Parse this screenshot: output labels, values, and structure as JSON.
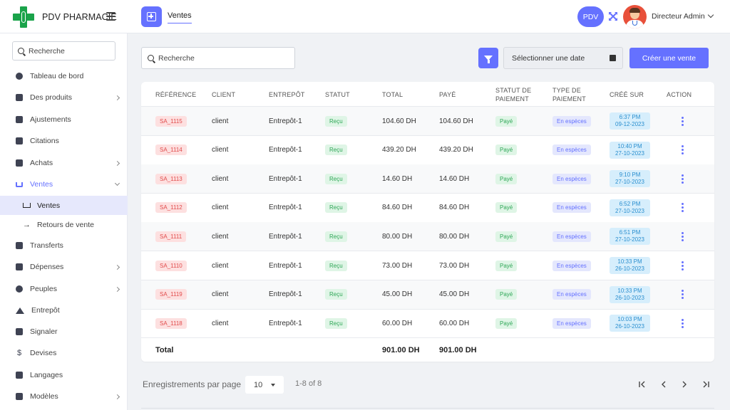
{
  "brand": {
    "name": "PDV PHARMACIE"
  },
  "header": {
    "tab_label": "Ventes",
    "pdv_label": "PDV",
    "user_name": "Directeur Admin"
  },
  "sidebar": {
    "search_placeholder": "Recherche",
    "items": [
      {
        "label": "Tableau de bord",
        "icon": "dashboard-icon"
      },
      {
        "label": "Des produits",
        "icon": "products-icon"
      },
      {
        "label": "Ajustements",
        "icon": "adjustments-icon"
      },
      {
        "label": "Citations",
        "icon": "quotations-icon"
      },
      {
        "label": "Achats",
        "icon": "purchases-icon"
      },
      {
        "label": "Ventes",
        "icon": "cart-icon"
      },
      {
        "label": "Transferts",
        "icon": "transfers-icon"
      },
      {
        "label": "Dépenses",
        "icon": "expenses-icon"
      },
      {
        "label": "Peuples",
        "icon": "people-icon"
      },
      {
        "label": "Entrepôt",
        "icon": "warehouse-icon"
      },
      {
        "label": "Signaler",
        "icon": "report-icon"
      },
      {
        "label": "Devises",
        "icon": "dollar-icon"
      },
      {
        "label": "Langages",
        "icon": "languages-icon"
      },
      {
        "label": "Modèles",
        "icon": "templates-icon"
      }
    ],
    "sub_items": [
      {
        "label": "Ventes",
        "icon": "cart-icon"
      },
      {
        "label": "Retours de vente",
        "icon": "arrow-right-icon"
      }
    ]
  },
  "toolbar": {
    "search_placeholder": "Recherche",
    "date_placeholder": "Sélectionner une date",
    "create_label": "Créer une vente"
  },
  "table": {
    "headers": {
      "reference": "RÉFÉRENCE",
      "client": "CLIENT",
      "warehouse": "ENTREPÔT",
      "status": "STATUT",
      "total": "TOTAL",
      "paid": "PAYÉ",
      "payment_status_1": "STATUT DE",
      "payment_status_2": "PAIEMENT",
      "payment_type_1": "TYPE DE",
      "payment_type_2": "PAIEMENT",
      "created_at": "CRÉÉ SUR",
      "action": "ACTION"
    },
    "rows": [
      {
        "ref": "SA_1115",
        "client": "client",
        "warehouse": "Entrepôt-1",
        "status": "Reçu",
        "total": "104.60 DH",
        "paid": "104.60 DH",
        "payment_status": "Payé",
        "payment_type": "En espèces",
        "time": "6:37 PM",
        "date": "09-12-2023"
      },
      {
        "ref": "SA_1114",
        "client": "client",
        "warehouse": "Entrepôt-1",
        "status": "Reçu",
        "total": "439.20 DH",
        "paid": "439.20 DH",
        "payment_status": "Payé",
        "payment_type": "En espèces",
        "time": "10:40 PM",
        "date": "27-10-2023"
      },
      {
        "ref": "SA_1113",
        "client": "client",
        "warehouse": "Entrepôt-1",
        "status": "Reçu",
        "total": "14.60 DH",
        "paid": "14.60 DH",
        "payment_status": "Payé",
        "payment_type": "En espèces",
        "time": "9:10 PM",
        "date": "27-10-2023"
      },
      {
        "ref": "SA_1112",
        "client": "client",
        "warehouse": "Entrepôt-1",
        "status": "Reçu",
        "total": "84.60 DH",
        "paid": "84.60 DH",
        "payment_status": "Payé",
        "payment_type": "En espèces",
        "time": "6:52 PM",
        "date": "27-10-2023"
      },
      {
        "ref": "SA_1111",
        "client": "client",
        "warehouse": "Entrepôt-1",
        "status": "Reçu",
        "total": "80.00 DH",
        "paid": "80.00 DH",
        "payment_status": "Payé",
        "payment_type": "En espèces",
        "time": "6:51 PM",
        "date": "27-10-2023"
      },
      {
        "ref": "SA_1110",
        "client": "client",
        "warehouse": "Entrepôt-1",
        "status": "Reçu",
        "total": "73.00 DH",
        "paid": "73.00 DH",
        "payment_status": "Payé",
        "payment_type": "En espèces",
        "time": "10:33 PM",
        "date": "26-10-2023"
      },
      {
        "ref": "SA_1119",
        "client": "client",
        "warehouse": "Entrepôt-1",
        "status": "Reçu",
        "total": "45.00 DH",
        "paid": "45.00 DH",
        "payment_status": "Payé",
        "payment_type": "En espèces",
        "time": "10:33 PM",
        "date": "26-10-2023"
      },
      {
        "ref": "SA_1118",
        "client": "client",
        "warehouse": "Entrepôt-1",
        "status": "Reçu",
        "total": "60.00 DH",
        "paid": "60.00 DH",
        "payment_status": "Payé",
        "payment_type": "En espèces",
        "time": "10:03 PM",
        "date": "26-10-2023"
      }
    ],
    "total_label": "Total",
    "total_amount": "901.00 DH",
    "total_paid": "901.00 DH"
  },
  "pagination": {
    "per_page_label": "Enregistrements par page",
    "per_page_value": "10",
    "range": "1-8 of 8",
    "first": "|<",
    "prev": "<",
    "next": ">",
    "last": ">|"
  },
  "colors": {
    "accent": "#6571ff",
    "brand_green": "#1aa34a",
    "badge_red": "#e14b4b",
    "badge_green": "#2fa757",
    "badge_blue": "#2b8fcf"
  }
}
